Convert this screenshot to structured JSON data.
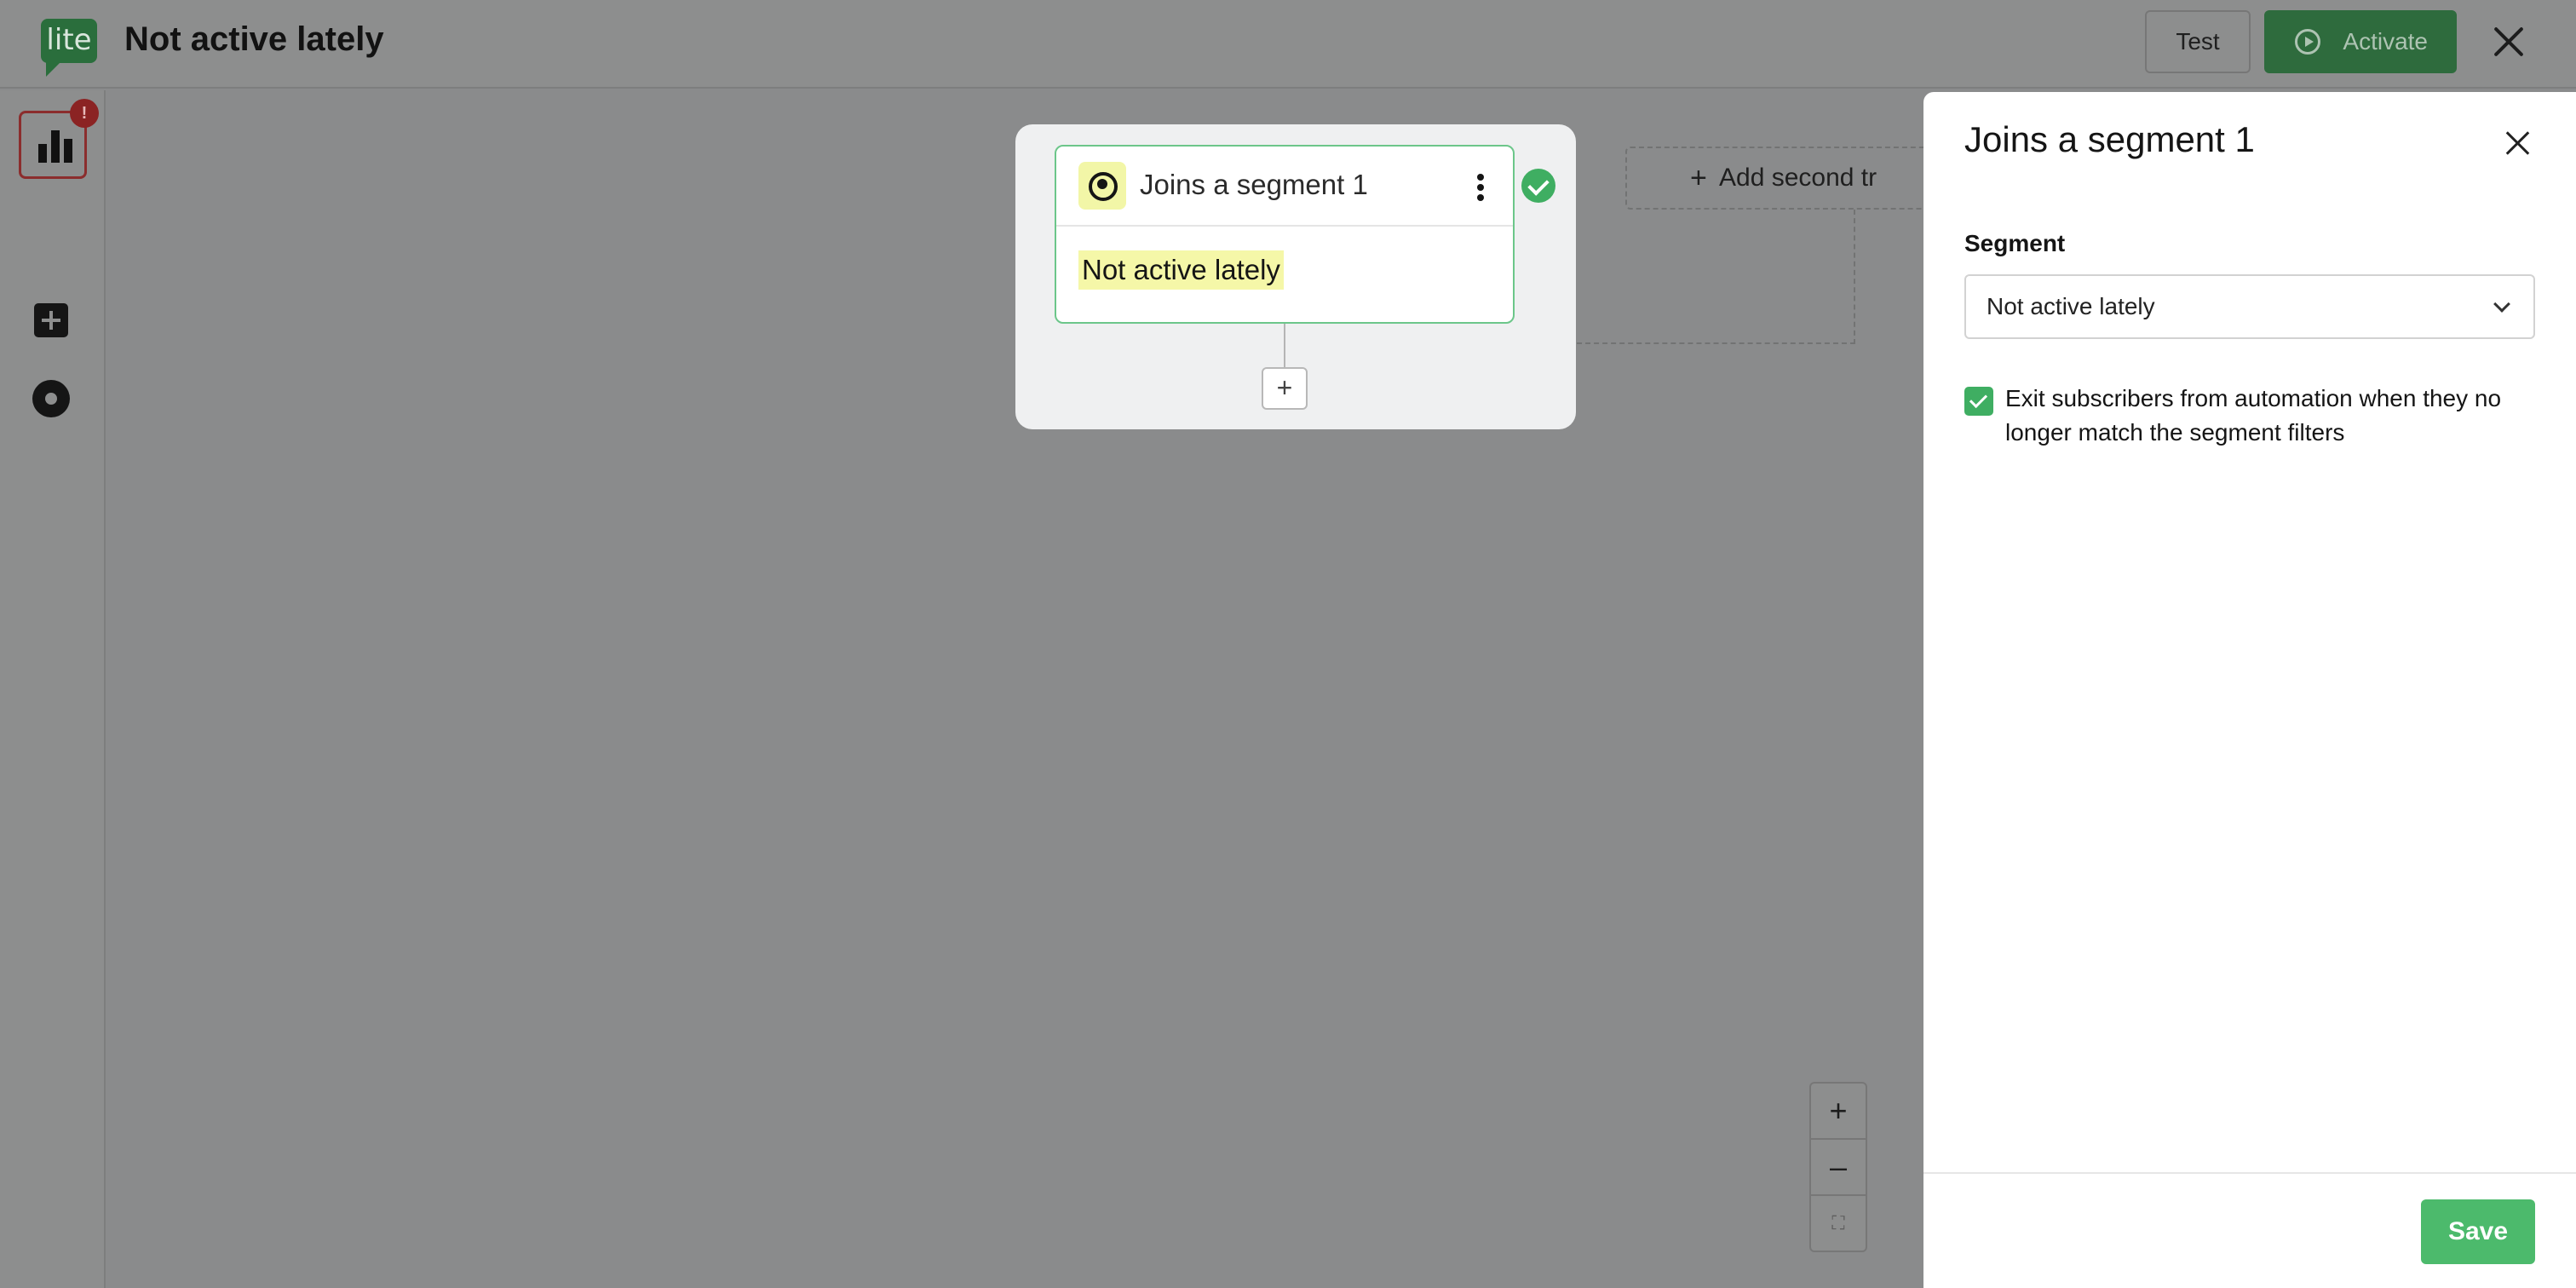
{
  "header": {
    "logo_text": "lite",
    "title": "Not active lately",
    "test_label": "Test",
    "activate_label": "Activate"
  },
  "sidebar": {
    "badge": "!"
  },
  "canvas": {
    "trigger": {
      "title": "Joins a segment 1",
      "value": "Not active lately"
    },
    "add_step_label": "+",
    "second_trigger_label": "Add second tr",
    "zoom": {
      "in": "+",
      "out": "–",
      "fit": "⛶"
    }
  },
  "panel": {
    "title": "Joins a segment 1",
    "segment_label": "Segment",
    "segment_value": "Not active lately",
    "exit_checkbox_label": "Exit subscribers from automation when they no longer match the segment filters",
    "exit_checked": true,
    "save_label": "Save"
  },
  "colors": {
    "brand_green": "#4cba6c",
    "success_green": "#3fae62",
    "highlight_yellow": "#f5f7a8",
    "alert_red": "#8b2323"
  }
}
